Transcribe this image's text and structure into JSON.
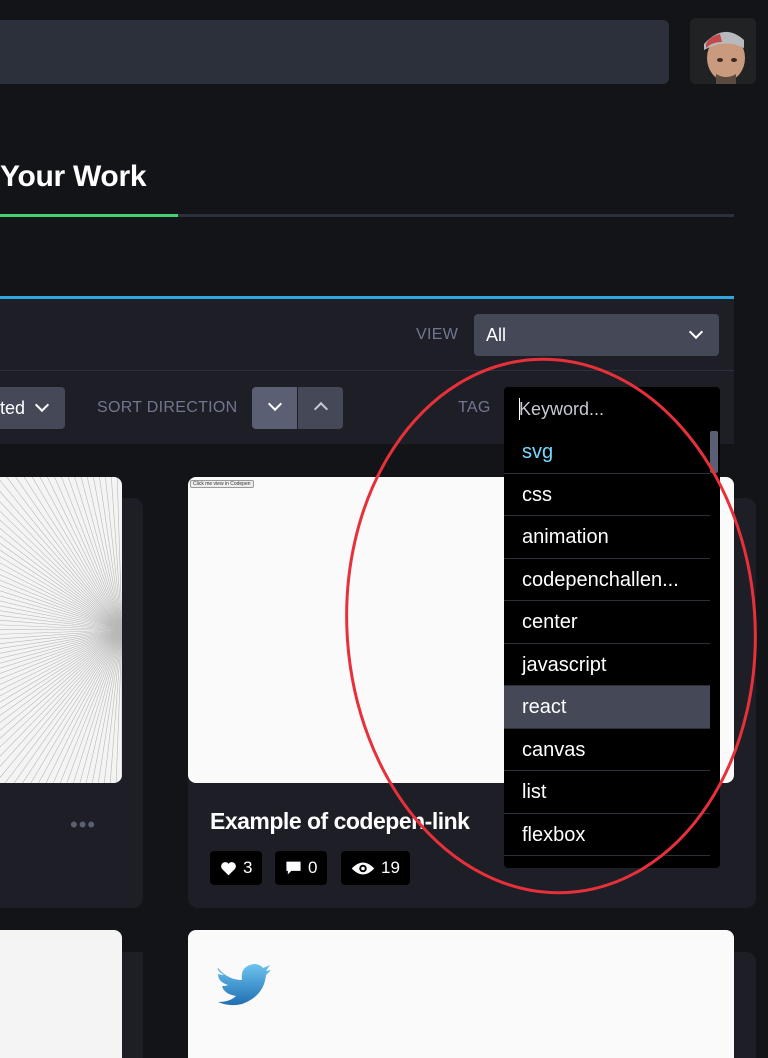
{
  "header": {
    "search_value": ""
  },
  "page": {
    "title": "Your Work"
  },
  "filters": {
    "view_label": "VIEW",
    "view_value": "All",
    "sort_value": "ted",
    "sort_direction_label": "SORT DIRECTION",
    "tag_label": "TAG",
    "tag_placeholder": "Keyword..."
  },
  "tags": [
    {
      "label": "svg",
      "state": "active"
    },
    {
      "label": "css",
      "state": ""
    },
    {
      "label": "animation",
      "state": ""
    },
    {
      "label": "codepenchallen...",
      "state": ""
    },
    {
      "label": "center",
      "state": ""
    },
    {
      "label": "javascript",
      "state": ""
    },
    {
      "label": "react",
      "state": "hover"
    },
    {
      "label": "canvas",
      "state": ""
    },
    {
      "label": "list",
      "state": ""
    },
    {
      "label": "flexbox",
      "state": ""
    }
  ],
  "cards": [
    {
      "title": "",
      "more_label": "•••"
    },
    {
      "title": "Example of codepen-link",
      "preview_button": "Click me view in Codepen",
      "likes": "3",
      "comments": "0",
      "views": "19"
    }
  ],
  "colors": {
    "accent_green": "#47cf73",
    "accent_blue": "#2ea7e0",
    "active_tag": "#76daff",
    "annotation_red": "#e8303b"
  },
  "icons": {
    "heart": "heart-icon",
    "comment": "comment-icon",
    "eye": "eye-icon",
    "bird": "twitter-bird-icon"
  }
}
